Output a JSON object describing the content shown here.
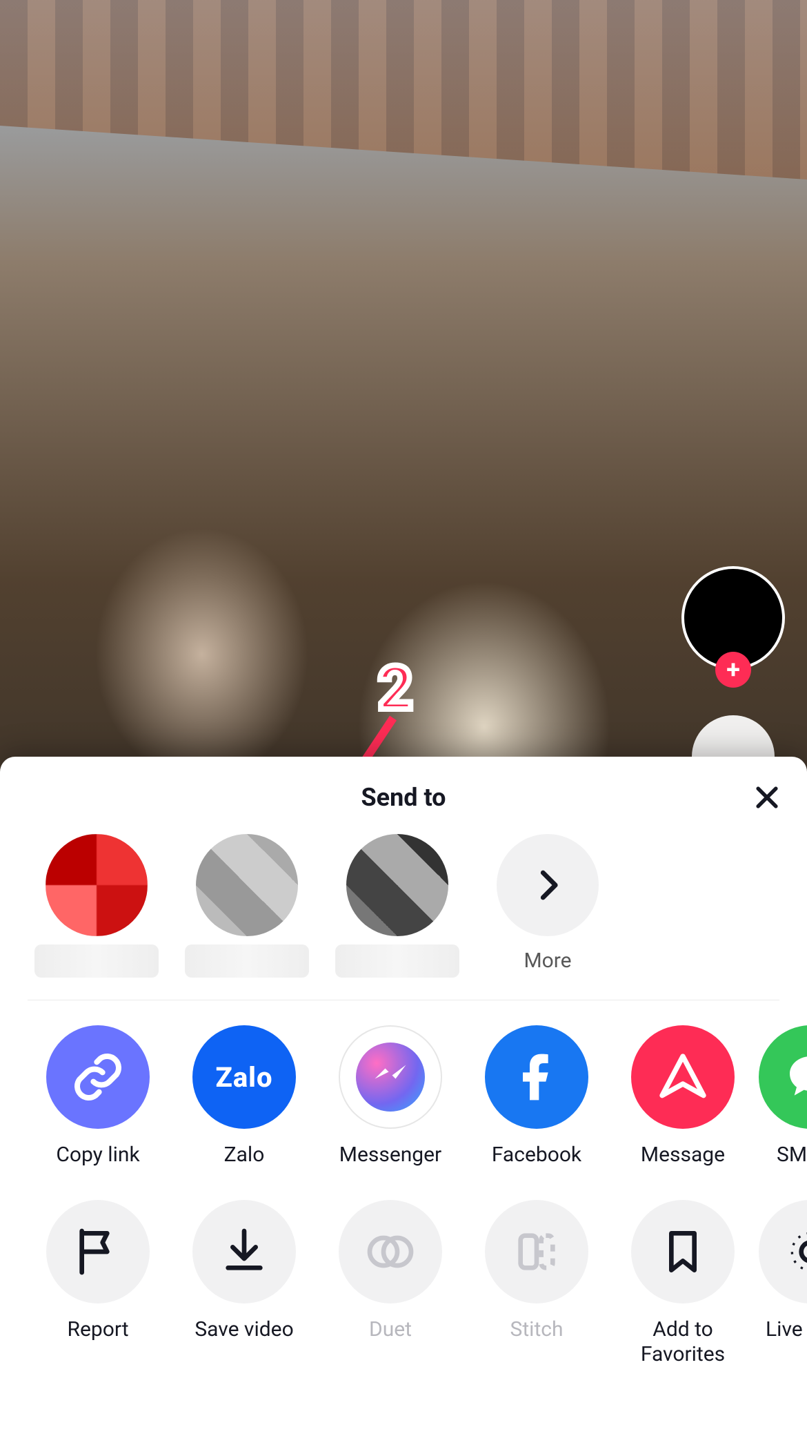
{
  "annotation": {
    "step_number": "2"
  },
  "video_rail": {
    "follow_plus": "+"
  },
  "sheet": {
    "title": "Send to",
    "more_label": "More",
    "share_targets": [
      {
        "id": "copy-link",
        "label": "Copy link"
      },
      {
        "id": "zalo",
        "label": "Zalo",
        "brand_text": "Zalo"
      },
      {
        "id": "messenger",
        "label": "Messenger"
      },
      {
        "id": "facebook",
        "label": "Facebook"
      },
      {
        "id": "message",
        "label": "Message"
      },
      {
        "id": "sms",
        "label": "SMS"
      }
    ],
    "actions": [
      {
        "id": "report",
        "label": "Report",
        "enabled": true
      },
      {
        "id": "save-video",
        "label": "Save video",
        "enabled": true
      },
      {
        "id": "duet",
        "label": "Duet",
        "enabled": false
      },
      {
        "id": "stitch",
        "label": "Stitch",
        "enabled": false
      },
      {
        "id": "add-to-favorites",
        "label": "Add to\nFavorites",
        "enabled": true
      },
      {
        "id": "live-photo",
        "label": "Live ph",
        "enabled": true
      }
    ]
  }
}
